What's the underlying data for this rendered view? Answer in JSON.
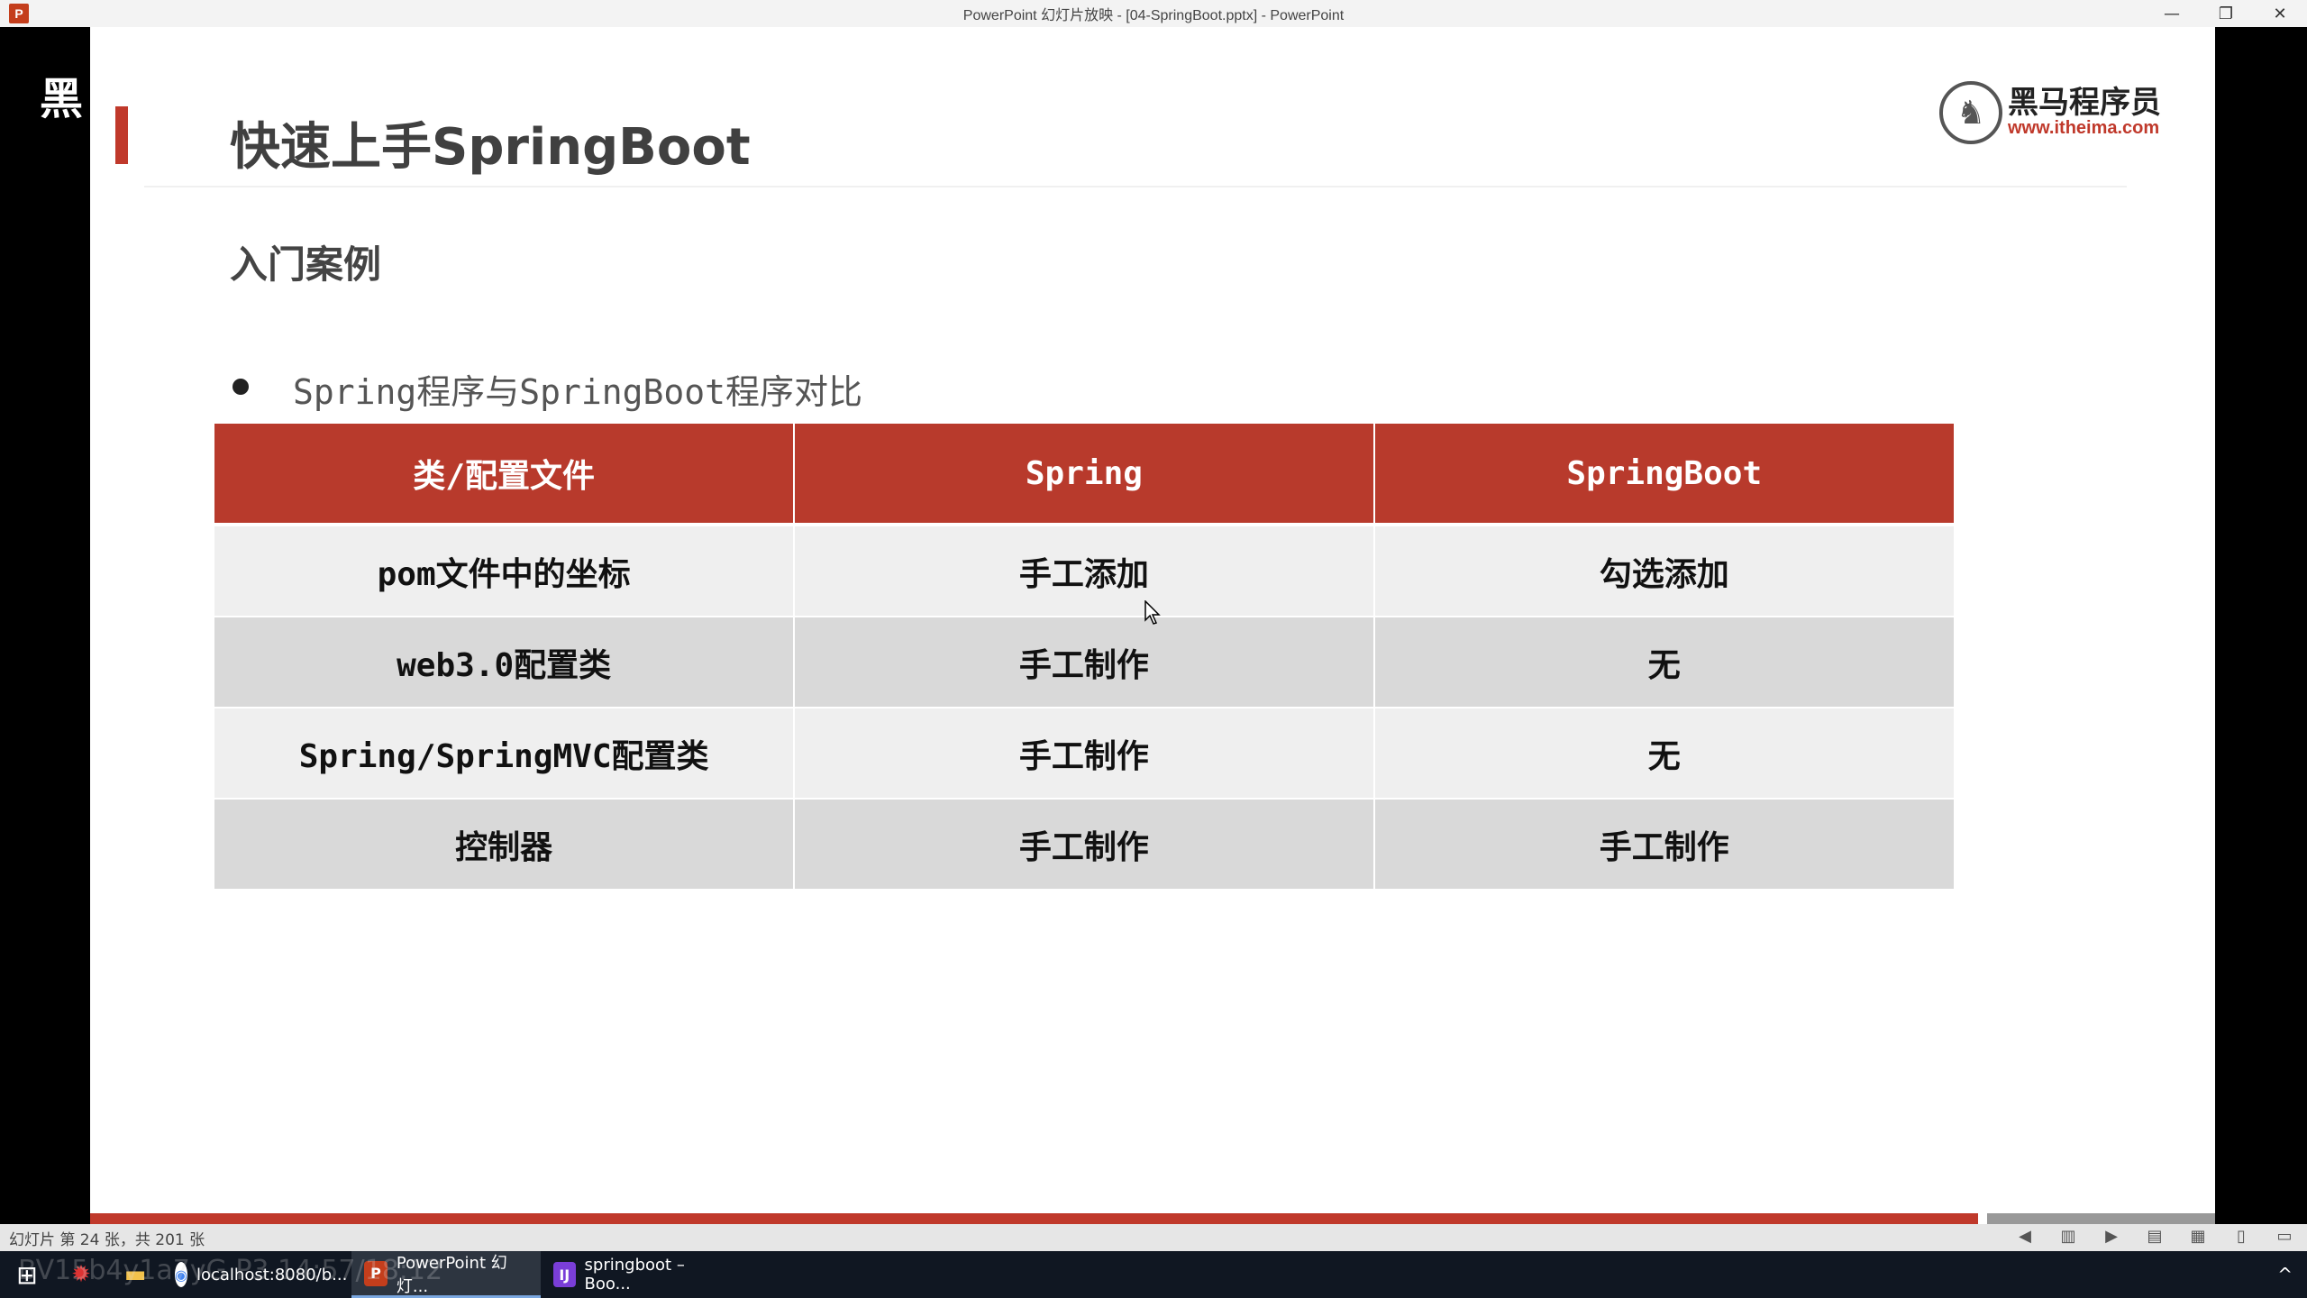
{
  "window": {
    "title": "PowerPoint 幻灯片放映 - [04-SpringBoot.pptx] - PowerPoint",
    "app_icon_letter": "P",
    "controls": [
      "—",
      "❐",
      "✕"
    ]
  },
  "watermark": {
    "main": "黑",
    "faded": ""
  },
  "slide": {
    "title": "快速上手SpringBoot",
    "logo": {
      "cn": "黑马程序员",
      "url": "www.itheima.com"
    },
    "subtitle": "入门案例",
    "bullet": "Spring程序与SpringBoot程序对比",
    "table": {
      "headers": [
        "类/配置文件",
        "Spring",
        "SpringBoot"
      ],
      "rows": [
        [
          "pom文件中的坐标",
          "手工添加",
          "勾选添加"
        ],
        [
          "web3.0配置类",
          "手工制作",
          "无"
        ],
        [
          "Spring/SpringMVC配置类",
          "手工制作",
          "无"
        ],
        [
          "控制器",
          "手工制作",
          "手工制作"
        ]
      ]
    },
    "accent_color": "#b83a2c"
  },
  "statusbar": {
    "slide_count": "幻灯片 第 24 张，共 201 张"
  },
  "taskbar": {
    "items": [
      {
        "label": "localhost:8080/b...",
        "icon": "chrome-icon"
      },
      {
        "label": "PowerPoint 幻灯...",
        "icon": "powerpoint-icon"
      },
      {
        "label": "springboot – Boo...",
        "icon": "intellij-icon"
      }
    ],
    "tray": "^"
  },
  "overlay_watermark": "BV15b4y1a7yG P3 14:57/18:12"
}
